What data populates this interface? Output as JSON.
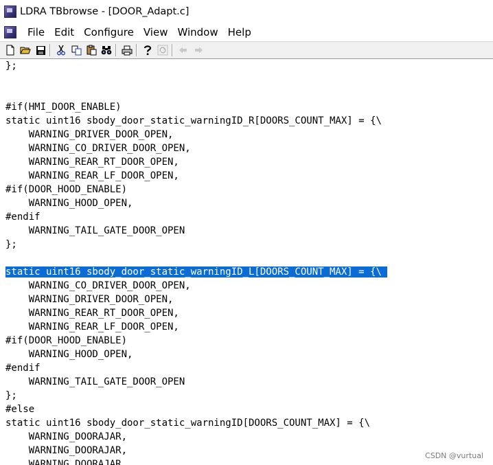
{
  "window": {
    "title": "LDRA TBbrowse - [DOOR_Adapt.c]"
  },
  "menu": {
    "items": [
      "File",
      "Edit",
      "Configure",
      "View",
      "Window",
      "Help"
    ]
  },
  "toolbar": {
    "buttons": [
      "new-file-icon",
      "open-folder-icon",
      "save-icon",
      "cut-icon",
      "copy-icon",
      "paste-icon",
      "find-icon",
      "print-icon",
      "help-icon",
      "refresh-icon",
      "back-arrow-icon",
      "forward-arrow-icon"
    ]
  },
  "editor": {
    "highlight_color": "#0a6cd4",
    "lines": [
      "};",
      "",
      "",
      "#if(HMI_DOOR_ENABLE)",
      "static uint16 sbody_door_static_warningID_R[DOORS_COUNT_MAX] = {\\",
      "    WARNING_DRIVER_DOOR_OPEN,",
      "    WARNING_CO_DRIVER_DOOR_OPEN,",
      "    WARNING_REAR_RT_DOOR_OPEN,",
      "    WARNING_REAR_LF_DOOR_OPEN,",
      "#if(DOOR_HOOD_ENABLE)",
      "    WARNING_HOOD_OPEN,",
      "#endif",
      "    WARNING_TAIL_GATE_DOOR_OPEN",
      "};",
      "",
      "static uint16 sbody_door_static_warningID_L[DOORS_COUNT_MAX] = {\\ ",
      "    WARNING_CO_DRIVER_DOOR_OPEN,",
      "    WARNING_DRIVER_DOOR_OPEN,",
      "    WARNING_REAR_RT_DOOR_OPEN,",
      "    WARNING_REAR_LF_DOOR_OPEN,",
      "#if(DOOR_HOOD_ENABLE)",
      "    WARNING_HOOD_OPEN,",
      "#endif",
      "    WARNING_TAIL_GATE_DOOR_OPEN",
      "};",
      "#else",
      "static uint16 sbody_door_static_warningID[DOORS_COUNT_MAX] = {\\",
      "    WARNING_DOORAJAR,",
      "    WARNING_DOORAJAR,",
      "    WARNING_DOORAJAR,"
    ]
  },
  "watermark": "CSDN @vurtual"
}
